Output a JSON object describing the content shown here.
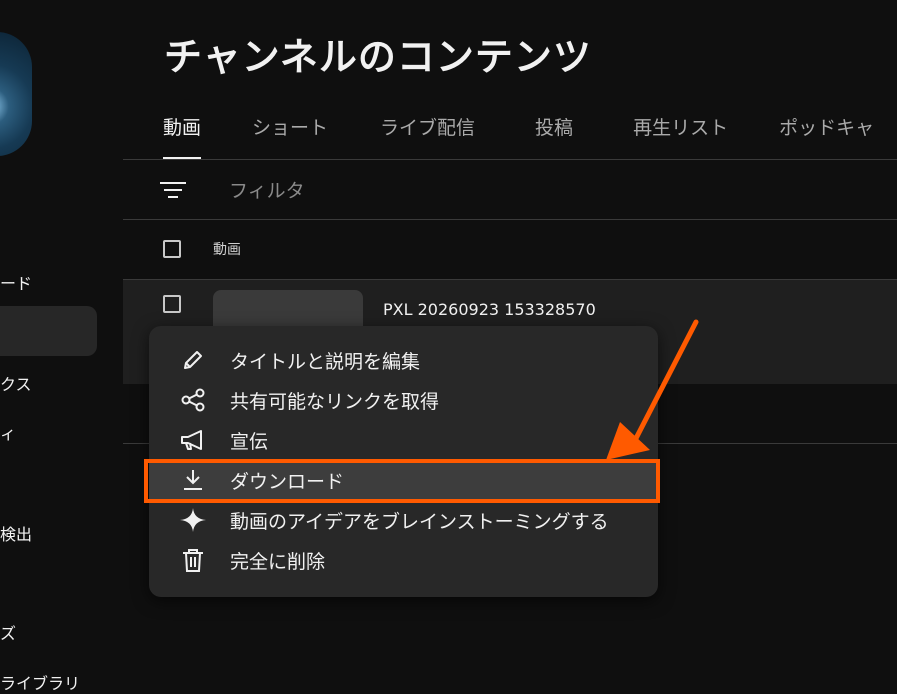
{
  "sidebar": {
    "items": [
      {
        "label": "ード"
      },
      {
        "label": "クス"
      },
      {
        "label": "ィ"
      },
      {
        "label": "検出"
      },
      {
        "label": "ズ"
      },
      {
        "label": "ライブラリ"
      }
    ]
  },
  "header": {
    "title": "チャンネルのコンテンツ"
  },
  "tabs": [
    {
      "label": "動画",
      "active": true
    },
    {
      "label": "ショート"
    },
    {
      "label": "ライブ配信"
    },
    {
      "label": "投稿"
    },
    {
      "label": "再生リスト"
    },
    {
      "label": "ポッドキャ"
    }
  ],
  "filter": {
    "placeholder": "フィルタ",
    "icon": "filter-icon"
  },
  "table": {
    "column_header": "動画",
    "rows": [
      {
        "title": "PXL 20260923 153328570"
      }
    ]
  },
  "menu": {
    "items": [
      {
        "label": "タイトルと説明を編集",
        "icon": "pencil-icon"
      },
      {
        "label": "共有可能なリンクを取得",
        "icon": "share-icon"
      },
      {
        "label": "宣伝",
        "icon": "megaphone-icon"
      },
      {
        "label": "ダウンロード",
        "icon": "download-icon"
      },
      {
        "label": "動画のアイデアをブレインストーミングする",
        "icon": "sparkle-icon"
      },
      {
        "label": "完全に削除",
        "icon": "trash-icon"
      }
    ]
  },
  "annotation": {
    "color": "#ff5a00"
  }
}
